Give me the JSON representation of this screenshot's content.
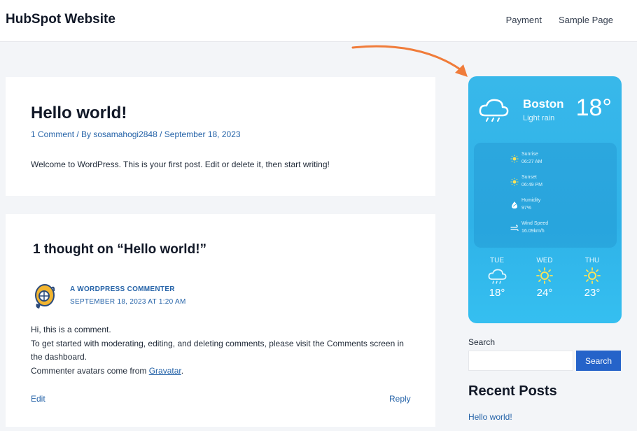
{
  "header": {
    "site_title": "HubSpot Website",
    "nav": [
      {
        "label": "Payment"
      },
      {
        "label": "Sample Page"
      }
    ]
  },
  "post": {
    "title": "Hello world!",
    "meta": {
      "comments": "1 Comment",
      "separator1": " / By ",
      "author": "sosamahogi2848",
      "separator2": " / ",
      "date": "September 18, 2023"
    },
    "body": "Welcome to WordPress. This is your first post. Edit or delete it, then start writing!"
  },
  "comments": {
    "heading": "1 thought on “Hello world!”",
    "items": [
      {
        "author": "A WORDPRESS COMMENTER",
        "date": "SEPTEMBER 18, 2023 AT 1:20 AM",
        "line1": "Hi, this is a comment.",
        "line2": "To get started with moderating, editing, and deleting comments, please visit the Comments screen in the dashboard.",
        "line3_prefix": "Commenter avatars come from ",
        "line3_link": "Gravatar",
        "line3_suffix": ".",
        "edit_label": "Edit",
        "reply_label": "Reply"
      }
    ]
  },
  "weather": {
    "city": "Boston",
    "condition": "Light rain",
    "temperature": "18°",
    "details": [
      {
        "label": "Sunrise",
        "value": "06:27 AM",
        "icon": "sunrise-icon"
      },
      {
        "label": "Sunset",
        "value": "06:49 PM",
        "icon": "sunset-icon"
      },
      {
        "label": "Humidity",
        "value": "97%",
        "icon": "humidity-icon"
      },
      {
        "label": "Wind Speed",
        "value": "16.09km/h",
        "icon": "wind-icon"
      }
    ],
    "forecast": [
      {
        "day": "TUE",
        "temp": "18°",
        "icon": "cloud-rain-icon"
      },
      {
        "day": "WED",
        "temp": "24°",
        "icon": "sun-icon"
      },
      {
        "day": "THU",
        "temp": "23°",
        "icon": "sun-icon"
      }
    ],
    "colors": {
      "card": "#38b8ea",
      "text": "#ffffff",
      "sun": "#f8e35a"
    }
  },
  "sidebar": {
    "search_label": "Search",
    "search_value": "",
    "search_button": "Search",
    "recent_heading": "Recent Posts",
    "recent_posts": [
      {
        "title": "Hello world!"
      }
    ]
  },
  "annotation": {
    "arrow_color": "#f07c3a"
  },
  "theme": {
    "link_color": "#2563a8",
    "button_color": "#2563c9"
  }
}
